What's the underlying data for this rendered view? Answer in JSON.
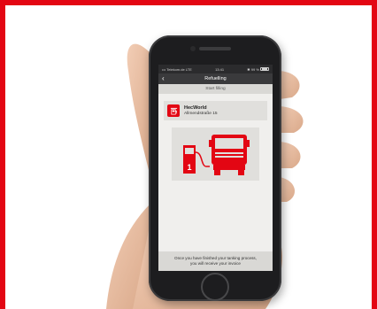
{
  "colors": {
    "brand_red": "#e30613",
    "frame_border": "#e30613",
    "phone_body": "#1d1d1f",
    "screen_bg": "#f0efed"
  },
  "status_bar": {
    "carrier": "••• Telekom.de  LTE",
    "time": "13:41",
    "battery": "✱ 99 %"
  },
  "nav": {
    "back_icon": "chevron-left-icon",
    "title": "Refuelling"
  },
  "subheader": {
    "label": "Start filling"
  },
  "station": {
    "icon": "fuel-station-icon",
    "name": "HecWorld",
    "address": "Allmendstraße 15"
  },
  "illustration": {
    "icon": "truck-refuelling-icon",
    "pump_number": "1"
  },
  "footer": {
    "line1": "Once you have finished your tanking process,",
    "line2": "you will receive your invoice"
  }
}
